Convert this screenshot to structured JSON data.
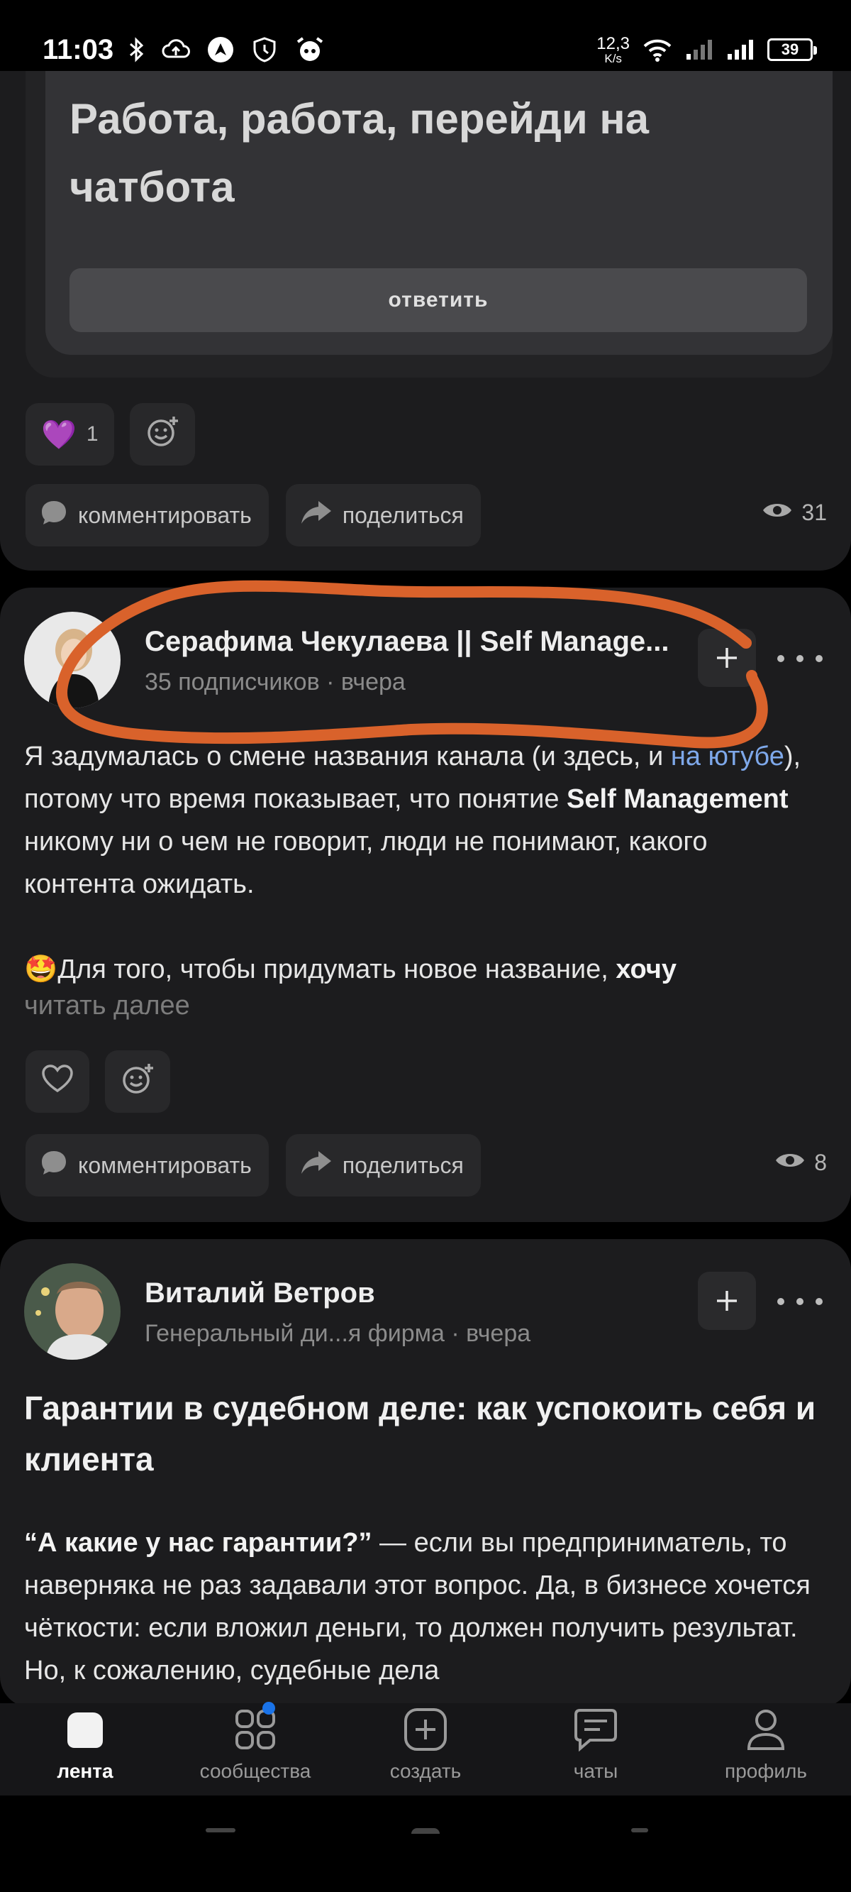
{
  "status_bar": {
    "time": "11:03",
    "net_speed_value": "12,3",
    "net_speed_unit": "K/s",
    "battery": "39",
    "icons": [
      "bluetooth-icon",
      "cloud-upload-icon",
      "arrow-app-icon",
      "shield-app-icon",
      "alarm-bot-icon",
      "wifi-icon",
      "signal-icon",
      "signal-icon-2"
    ]
  },
  "post_1": {
    "quote_text": "Работа, работа, перейди на чатбота",
    "reply_label": "ответить",
    "reaction_emoji": "💜",
    "reaction_count": "1",
    "comment_label": "комментировать",
    "share_label": "поделиться",
    "views": "31"
  },
  "post_2": {
    "author": "Серафима Чекулаева || Self Manage...",
    "meta": "35 подписчиков · вчера",
    "body_part1": "Я задумалась о смене названия канала (и здесь, и ",
    "body_link": "на ютубе",
    "body_part2": "), потому что время показывает, что понятие ",
    "body_bold": "Self Management",
    "body_part3": " никому ни о чем не говорит, люди не понимают, какого контента ожидать.",
    "body_emoji": "🤩",
    "body_para2": "Для того, чтобы придумать новое название, ",
    "body_para2_bold": "хочу",
    "read_more": "читать далее",
    "comment_label": "комментировать",
    "share_label": "поделиться",
    "views": "8"
  },
  "post_3": {
    "author": "Виталий Ветров",
    "meta": "Генеральный ди...я фирма · вчера",
    "title": "Гарантии в судебном деле: как успокоить себя и клиента",
    "body_bold": "“А какие у нас гарантии?”",
    "body_rest": " — если вы предприниматель, то наверняка не раз задавали этот вопрос. Да, в бизнесе хочется чёткости: если вложил деньги, то должен получить результат. Но, к сожалению, судебные дела"
  },
  "bottom_nav": [
    {
      "label": "лента",
      "icon": "feed-icon",
      "active": true
    },
    {
      "label": "сообщества",
      "icon": "communities-icon",
      "active": false
    },
    {
      "label": "создать",
      "icon": "create-icon",
      "active": false
    },
    {
      "label": "чаты",
      "icon": "chats-icon",
      "active": false
    },
    {
      "label": "профиль",
      "icon": "profile-icon",
      "active": false
    }
  ],
  "colors": {
    "card_bg": "#1c1c1e",
    "link": "#7ea8ea",
    "highlight": "#d9622b",
    "notification_dot": "#1a73e8"
  }
}
